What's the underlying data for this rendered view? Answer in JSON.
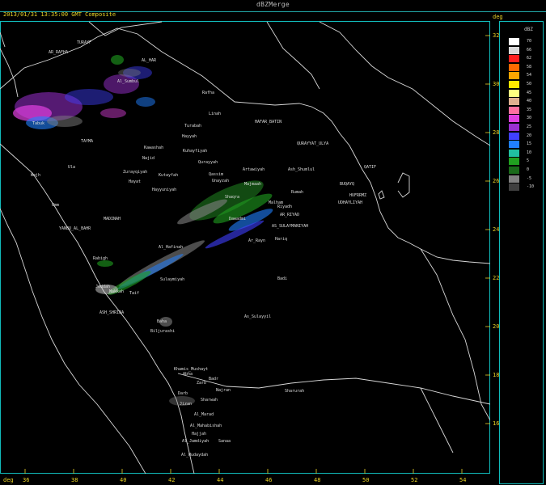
{
  "window": {
    "title": "dBZMerge"
  },
  "header": {
    "timestamp": "2013/01/31 13:35:00 GMT Composite",
    "units_right": "deg",
    "units_bottom": "deg"
  },
  "axes": {
    "latitudes": [
      "32",
      "30",
      "28",
      "26",
      "24",
      "22",
      "20",
      "18",
      "16"
    ],
    "longitudes": [
      "36",
      "38",
      "40",
      "42",
      "44",
      "46",
      "48",
      "50",
      "52",
      "54"
    ]
  },
  "legend": {
    "title": "dBZ",
    "entries": [
      {
        "label": "70",
        "color": "#ffffff"
      },
      {
        "label": "66",
        "color": "#d9d9d9"
      },
      {
        "label": "62",
        "color": "#ff2020"
      },
      {
        "label": "58",
        "color": "#ff6a00"
      },
      {
        "label": "54",
        "color": "#ffa600"
      },
      {
        "label": "50",
        "color": "#ffe800"
      },
      {
        "label": "45",
        "color": "#ffff80"
      },
      {
        "label": "40",
        "color": "#e0b090"
      },
      {
        "label": "35",
        "color": "#ff70a0"
      },
      {
        "label": "30",
        "color": "#e040e0"
      },
      {
        "label": "25",
        "color": "#9a30d0"
      },
      {
        "label": "20",
        "color": "#4040ff"
      },
      {
        "label": "15",
        "color": "#2080ff"
      },
      {
        "label": "10",
        "color": "#20c0a0"
      },
      {
        "label": "5",
        "color": "#20a020"
      },
      {
        "label": "0",
        "color": "#1a6a1a"
      },
      {
        "label": "-5",
        "color": "#808080"
      },
      {
        "label": "-10",
        "color": "#404040"
      }
    ]
  },
  "places": [
    {
      "name": "TURAYF"
    },
    {
      "name": "AR_RAFHA"
    },
    {
      "name": "AL_HAR"
    },
    {
      "name": "Al_Sumbul"
    },
    {
      "name": "Rafha"
    },
    {
      "name": "Linah"
    },
    {
      "name": "HAFAR_BATIN"
    },
    {
      "name": "Turabah"
    },
    {
      "name": "Hayyah"
    },
    {
      "name": "Kuhayfiyah"
    },
    {
      "name": "QURAYYAT_ULYA"
    },
    {
      "name": "Qurayyah"
    },
    {
      "name": "Tabuk"
    },
    {
      "name": "TAYMA"
    },
    {
      "name": "Kawashah"
    },
    {
      "name": "Najid"
    },
    {
      "name": "Qassim"
    },
    {
      "name": "Artawiyah"
    },
    {
      "name": "Ash_Shumlul"
    },
    {
      "name": "QATIF"
    },
    {
      "name": "Wajh"
    },
    {
      "name": "Ula"
    },
    {
      "name": "Zurayqiyah"
    },
    {
      "name": "Kutayfah"
    },
    {
      "name": "Hayat"
    },
    {
      "name": "Hayyuniyah"
    },
    {
      "name": "Unayzah"
    },
    {
      "name": "Majmaah"
    },
    {
      "name": "Rumah"
    },
    {
      "name": "BUQAYQ"
    },
    {
      "name": "HUFRRMZ"
    },
    {
      "name": "UDHAYLIYAH"
    },
    {
      "name": "Umm"
    },
    {
      "name": "Shaqra"
    },
    {
      "name": "Malham"
    },
    {
      "name": "Riyadh"
    },
    {
      "name": "AR_RIYAD"
    },
    {
      "name": "MADINAH"
    },
    {
      "name": "YANBU_AL_BAHR"
    },
    {
      "name": "Dawadmi"
    },
    {
      "name": "AS_SULAYMANIYAH"
    },
    {
      "name": "Ar_Rayn"
    },
    {
      "name": "Hariq"
    },
    {
      "name": "Al_Hafinah"
    },
    {
      "name": "Rabigh"
    },
    {
      "name": "Badi"
    },
    {
      "name": "Jeddah"
    },
    {
      "name": "Makkah"
    },
    {
      "name": "Sulaymiyah"
    },
    {
      "name": "Taif"
    },
    {
      "name": "ASH_SHRIBA"
    },
    {
      "name": "As_Sulayyil"
    },
    {
      "name": "Baha"
    },
    {
      "name": "Biljurashi"
    },
    {
      "name": "Khamis_Mushayt"
    },
    {
      "name": "Abha"
    },
    {
      "name": "Badr"
    },
    {
      "name": "Zarb"
    },
    {
      "name": "Najran"
    },
    {
      "name": "Darb"
    },
    {
      "name": "Sharurah"
    },
    {
      "name": "Sharwah"
    },
    {
      "name": "Jizan"
    },
    {
      "name": "Al_Marad"
    },
    {
      "name": "Al_Mahabishah"
    },
    {
      "name": "Hajjah"
    },
    {
      "name": "Al_Jamdiyah"
    },
    {
      "name": "Sanaa"
    },
    {
      "name": "Al_Hudaydah"
    }
  ]
}
